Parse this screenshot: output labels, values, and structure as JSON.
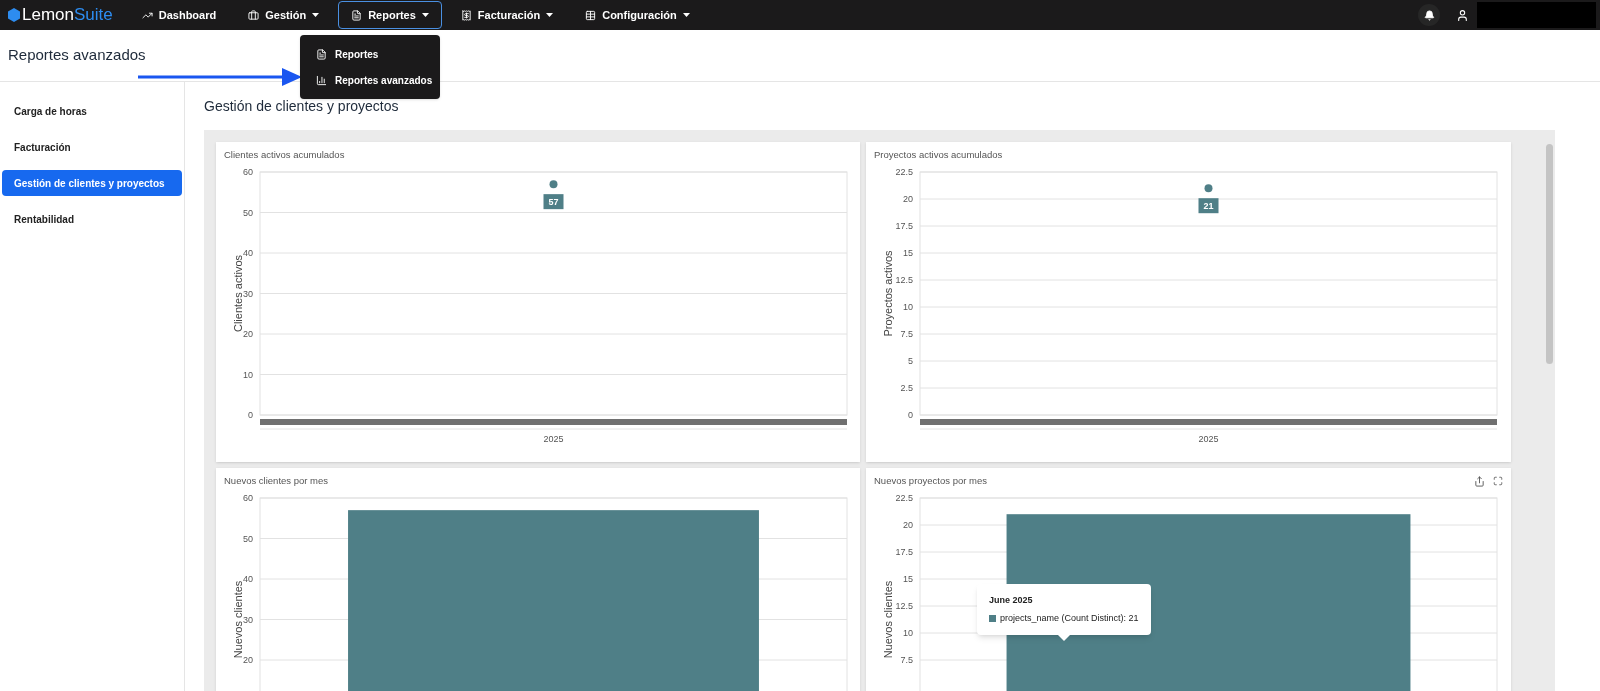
{
  "navbar": {
    "logo": {
      "part_1": "Lemon",
      "part_2": "Suite"
    },
    "items": [
      {
        "label": "Dashboard",
        "dropdown": false,
        "selected": false
      },
      {
        "label": "Gestión",
        "dropdown": true,
        "selected": false
      },
      {
        "label": "Reportes",
        "dropdown": true,
        "selected": true
      },
      {
        "label": "Facturación",
        "dropdown": true,
        "selected": false
      },
      {
        "label": "Configuración",
        "dropdown": true,
        "selected": false
      }
    ]
  },
  "dropdown_menu": {
    "items": [
      {
        "label": "Reportes"
      },
      {
        "label": "Reportes avanzados"
      }
    ]
  },
  "page_title": "Reportes avanzados",
  "sidebar": {
    "items": [
      {
        "label": "Carga de horas",
        "selected": false
      },
      {
        "label": "Facturación",
        "selected": false
      },
      {
        "label": "Gestión de clientes y proyectos",
        "selected": true
      },
      {
        "label": "Rentabilidad",
        "selected": false
      }
    ]
  },
  "section_title": "Gestión de clientes y proyectos",
  "charts": [
    {
      "title": "Clientes activos acumulados",
      "actions": false,
      "chart_data": {
        "type": "line",
        "ylabel": "Clientes activos",
        "categories": [
          "2025"
        ],
        "series": [
          {
            "color": "#4f7f87",
            "values": [
              57
            ],
            "marker": "circle"
          }
        ],
        "ylim": [
          0,
          60
        ],
        "yticks": [
          0,
          10,
          20,
          30,
          40,
          50,
          60
        ],
        "grid": true,
        "data_labels": true
      }
    },
    {
      "title": "Proyectos activos acumulados",
      "actions": false,
      "chart_data": {
        "type": "line",
        "ylabel": "Proyectos activos",
        "categories": [
          "2025"
        ],
        "series": [
          {
            "color": "#4f7f87",
            "values": [
              21
            ],
            "marker": "circle"
          }
        ],
        "ylim": [
          0,
          22.5
        ],
        "yticks": [
          0,
          2.5,
          5,
          7.5,
          10,
          12.5,
          15,
          17.5,
          20,
          22.5
        ],
        "grid": true,
        "data_labels": true
      }
    },
    {
      "title": "Nuevos clientes por mes",
      "actions": false,
      "chart_data": {
        "type": "bar",
        "ylabel": "Nuevos clientes",
        "series": [
          {
            "color": "#4f7f87",
            "values": [
              57
            ]
          }
        ],
        "ylim": [
          0,
          60
        ],
        "yticks": [
          20,
          30,
          40,
          50,
          60
        ],
        "grid": true
      }
    },
    {
      "title": "Nuevos proyectos por mes",
      "actions": true,
      "chart_data": {
        "type": "bar",
        "ylabel": "Nuevos clientes",
        "series": [
          {
            "color": "#4f7f87",
            "values": [
              21
            ]
          }
        ],
        "ylim": [
          0,
          22.5
        ],
        "yticks": [
          7.5,
          10,
          12.5,
          15,
          17.5,
          20,
          22.5
        ],
        "grid": true
      },
      "tooltip": {
        "title": "June 2025",
        "text": "projects_name (Count Distinct): 21"
      }
    }
  ]
}
